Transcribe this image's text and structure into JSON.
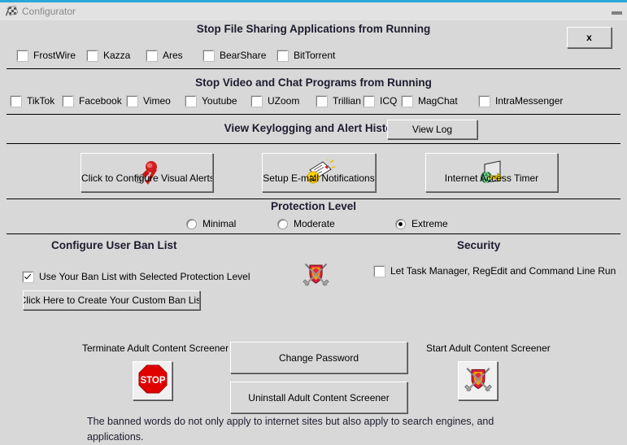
{
  "window": {
    "title": "Configurator",
    "icon": "checkered-flag-icon",
    "minimize_label": "_",
    "accent_color": "#29a8d8",
    "face_color": "#d8d8d8"
  },
  "close_button": {
    "label": "x"
  },
  "sections": {
    "file_sharing": {
      "heading": "Stop File Sharing Applications from Running",
      "checkboxes": [
        {
          "label": "FrostWire",
          "checked": false
        },
        {
          "label": "Kazza",
          "checked": false
        },
        {
          "label": "Ares",
          "checked": false
        },
        {
          "label": "BearShare",
          "checked": false
        },
        {
          "label": "BitTorrent",
          "checked": false
        }
      ]
    },
    "video_chat": {
      "heading": "Stop Video and Chat Programs from Running",
      "checkboxes": [
        {
          "label": "TikTok",
          "checked": false
        },
        {
          "label": "Facebook",
          "checked": false
        },
        {
          "label": "Vimeo",
          "checked": false
        },
        {
          "label": "Youtube",
          "checked": false
        },
        {
          "label": "UZoom",
          "checked": false
        },
        {
          "label": "Trillian",
          "checked": false
        },
        {
          "label": "ICQ",
          "checked": false
        },
        {
          "label": "MagChat",
          "checked": false
        },
        {
          "label": "IntraMessenger",
          "checked": false
        }
      ]
    },
    "keylogging": {
      "heading": "View Keylogging and Alert History",
      "view_log_label": "View Log"
    },
    "feature_buttons": [
      {
        "label": "Click to Configure Visual Alerts",
        "icon": "megaphone-check-icon"
      },
      {
        "label": "Setup E-mail Notifications",
        "icon": "email-notification-icon"
      },
      {
        "label": "Internet Access Timer",
        "icon": "globe-door-icon"
      }
    ],
    "protection_level": {
      "heading": "Protection Level",
      "options": [
        {
          "label": "Minimal",
          "selected": false
        },
        {
          "label": "Moderate",
          "selected": false
        },
        {
          "label": "Extreme",
          "selected": true
        }
      ]
    },
    "ban_list": {
      "heading": "Configure User Ban List",
      "use_ban_list": {
        "label": "Use Your Ban List with Selected Protection Level",
        "checked": true
      },
      "create_button": "Click Here to Create Your Custom Ban List"
    },
    "security": {
      "heading": "Security",
      "icon": "crossed-swords-shield-icon",
      "allow_tools": {
        "label": "Let  Task Manager, RegEdit and Command Line Run",
        "checked": false
      }
    },
    "bottom": {
      "terminate_label": "Terminate Adult Content Screener",
      "terminate_icon": "stop-sign-icon",
      "stop_sign_text": "STOP",
      "start_label": "Start Adult Content Screener",
      "start_icon": "crossed-swords-shield-icon",
      "change_password_label": "Change Password",
      "uninstall_label": "Uninstall Adult Content Screener",
      "note": "The banned words do not only apply to internet sites but also apply to search engines, and applications."
    }
  }
}
